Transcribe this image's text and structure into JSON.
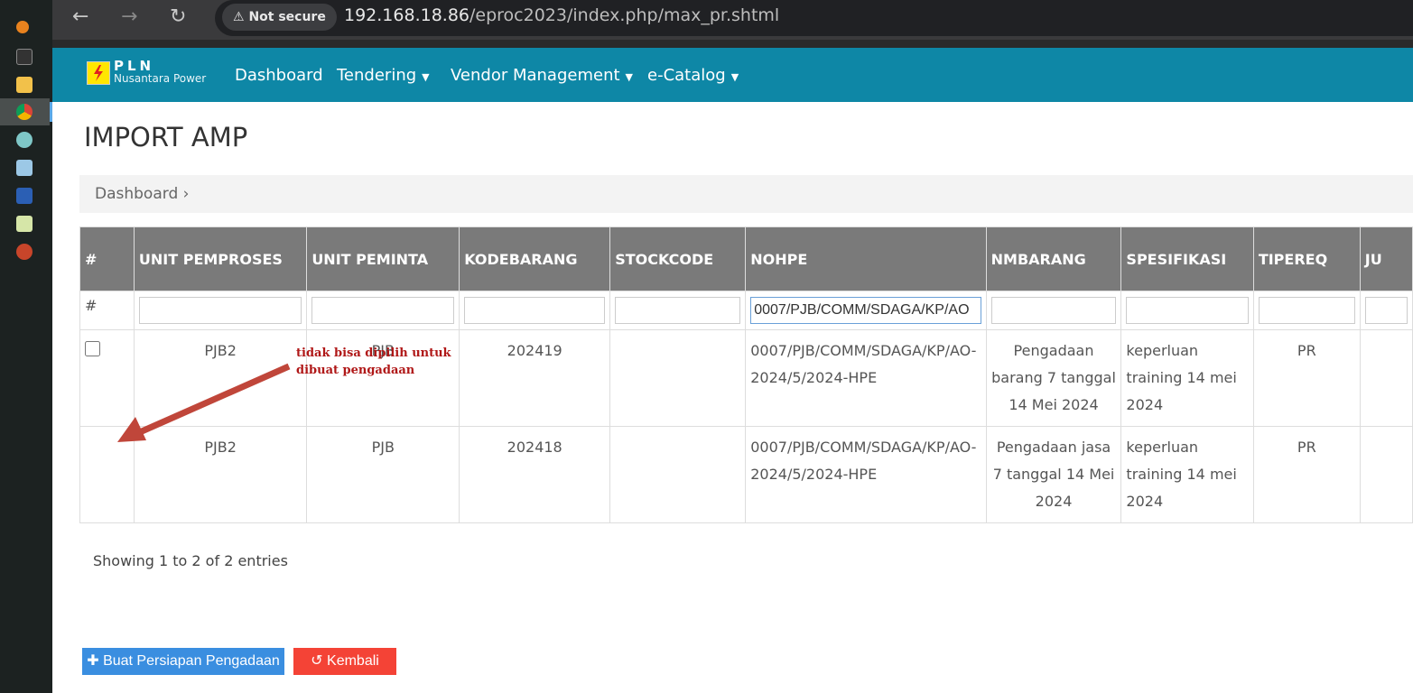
{
  "browser": {
    "not_secure": "Not secure",
    "url_host": "192.168.18.86",
    "url_path": "/eproc2023/index.php/max_pr.shtml"
  },
  "navbar": {
    "logo_title": "PLN",
    "logo_subtitle": "Nusantara Power",
    "items": [
      {
        "label": "Dashboard"
      },
      {
        "label": "Tendering"
      },
      {
        "label": "Vendor Management"
      },
      {
        "label": "e-Catalog"
      }
    ]
  },
  "page": {
    "title": "IMPORT AMP",
    "breadcrumb": "Dashboard",
    "breadcrumb_sep": "›"
  },
  "table": {
    "headers": [
      "#",
      "UNIT PEMPROSES",
      "UNIT PEMINTA",
      "KODEBARANG",
      "STOCKCODE",
      "NOHPE",
      "NMBARANG",
      "SPESIFIKASI",
      "TIPEREQ",
      "JU"
    ],
    "filter_hash": "#",
    "filter_nohpe": "0007/PJB/COMM/SDAGA/KP/AO",
    "rows": [
      {
        "unit_pemproses": "PJB2",
        "unit_peminta": "PJB",
        "kodebarang": "202419",
        "stockcode": "",
        "nohpe": "0007/PJB/COMM/SDAGA/KP/AO-2024/5/2024-HPE",
        "nmbarang": "Pengadaan barang 7 tanggal 14 Mei 2024",
        "spesifikasi": "keperluan training 14 mei 2024",
        "tipereq": "PR"
      },
      {
        "unit_pemproses": "PJB2",
        "unit_peminta": "PJB",
        "kodebarang": "202418",
        "stockcode": "",
        "nohpe": "0007/PJB/COMM/SDAGA/KP/AO-2024/5/2024-HPE",
        "nmbarang": "Pengadaan jasa 7 tanggal 14 Mei 2024",
        "spesifikasi": "keperluan training 14 mei 2024",
        "tipereq": "PR"
      }
    ]
  },
  "annotation": "tidak bisa dipilih untuk dibuat pengadaan",
  "info": "Showing 1 to 2 of 2 entries",
  "buttons": {
    "create": "Buat Persiapan Pengadaan",
    "back": "Kembali"
  },
  "colors": {
    "navbar": "#0e87a6",
    "create": "#3a8ee0",
    "back": "#f44336",
    "annotation": "#b01818",
    "arrow": "#c0463a"
  }
}
